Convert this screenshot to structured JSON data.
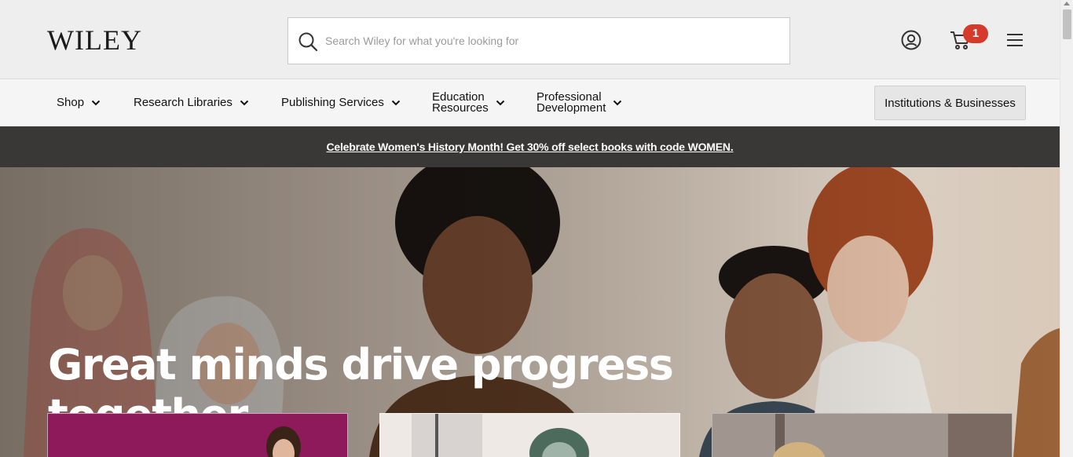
{
  "header": {
    "logo_text": "WILEY",
    "search": {
      "placeholder": "Search Wiley for what you're looking for",
      "value": ""
    },
    "account_icon": "user-circle-icon",
    "cart_icon": "shopping-cart-icon",
    "cart_count": "1",
    "menu_icon": "hamburger-menu-icon",
    "badge_color": "#d63a2a"
  },
  "nav": {
    "items": [
      {
        "label": "Shop"
      },
      {
        "label": "Research Libraries"
      },
      {
        "label": "Publishing Services"
      },
      {
        "label": "Education Resources",
        "line1": "Education",
        "line2": "Resources"
      },
      {
        "label": "Professional Development",
        "line1": "Professional",
        "line2": "Development"
      }
    ],
    "institutions_button": "Institutions & Businesses"
  },
  "promo": {
    "text_before": "Celebrate Women's History Month! Get ",
    "text_bold": "30% off",
    "text_middle": " select books with code ",
    "code": "WOMEN",
    "text_after": ".",
    "background": "#3a3836"
  },
  "hero": {
    "title": "Great minds drive progress together",
    "cards": [
      {
        "color": "#8e1a5c"
      },
      {
        "color": "#efe9e6"
      },
      {
        "color": "#5a4b44"
      }
    ]
  }
}
